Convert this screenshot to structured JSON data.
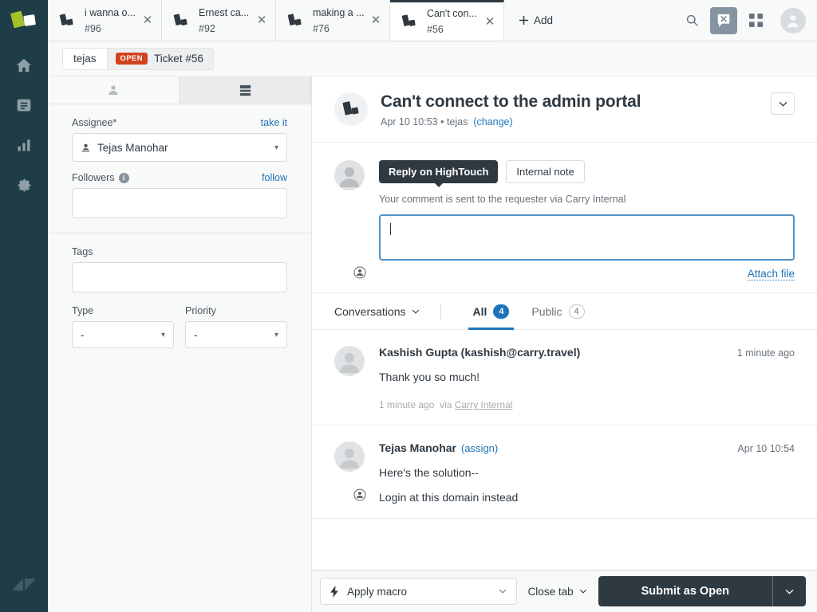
{
  "rail": {
    "logo_icon": "zendesk-cards-logo",
    "items": [
      {
        "icon": "home-icon",
        "name": "home"
      },
      {
        "icon": "views-list-icon",
        "name": "views"
      },
      {
        "icon": "reporting-bars-icon",
        "name": "reporting"
      },
      {
        "icon": "gear-icon",
        "name": "admin"
      }
    ],
    "footer_icon": "zendesk-logo"
  },
  "tabstrip": {
    "tabs": [
      {
        "title": "i wanna o...",
        "number": "#96",
        "active": false
      },
      {
        "title": "Ernest ca...",
        "number": "#92",
        "active": false
      },
      {
        "title": "making a ...",
        "number": "#76",
        "active": false
      },
      {
        "title": "Can't con...",
        "number": "#56",
        "active": true
      }
    ],
    "add_label": "Add",
    "close_glyph": "✕",
    "actions": [
      {
        "icon": "search-icon",
        "name": "search-button",
        "highlighted": false
      },
      {
        "icon": "chat-dismiss-icon",
        "name": "chat-status-button",
        "highlighted": true
      },
      {
        "icon": "apps-grid-icon",
        "name": "products-button",
        "highlighted": false
      }
    ],
    "avatar_icon": "user-avatar"
  },
  "breadcrumb": {
    "user": "tejas",
    "status": "OPEN",
    "ticket": "Ticket #56",
    "status_color": "#d2421c"
  },
  "properties": {
    "tabs": [
      {
        "icon": "user-icon",
        "name": "customer-context-tab",
        "active": true
      },
      {
        "icon": "apps-panel-icon",
        "name": "apps-tab",
        "active": false
      }
    ],
    "assignee": {
      "label": "Assignee*",
      "action": "take it",
      "value": "Tejas Manohar",
      "icon": "assignee-icon"
    },
    "followers": {
      "label": "Followers",
      "action": "follow",
      "value": "",
      "info_glyph": "i"
    },
    "tags": {
      "label": "Tags",
      "value": ""
    },
    "type": {
      "label": "Type",
      "value": "-"
    },
    "priority": {
      "label": "Priority",
      "value": "-"
    }
  },
  "ticket": {
    "icon": "ticket-cards-icon",
    "title": "Can't connect to the admin portal",
    "meta_date": "Apr 10 10:53",
    "meta_sep": "•",
    "meta_user": "tejas",
    "meta_change": "(change)",
    "options_caret": "⌄"
  },
  "composer": {
    "channel_active": "Reply on HighTouch",
    "channel_internal": "Internal note",
    "hint": "Your comment is sent to the requester via Carry Internal",
    "text": "",
    "attach_label": "Attach file",
    "avatar_icon": "agent-avatar"
  },
  "conversation": {
    "dropdown_label": "Conversations",
    "tabs": [
      {
        "label": "All",
        "count": "4",
        "active": true
      },
      {
        "label": "Public",
        "count": "4",
        "active": false
      }
    ],
    "accent_color": "#1f73b7"
  },
  "comments": [
    {
      "author": "Kashish Gupta (kashish@carry.travel)",
      "action": "",
      "time": "1 minute ago",
      "lines": [
        "Thank you so much!"
      ],
      "footer_time": "1 minute ago",
      "footer_via": "via",
      "footer_channel": "Carry Internal",
      "avatar_icon": "user-avatar",
      "has_agent_badge": false
    },
    {
      "author": "Tejas Manohar",
      "action": "(assign)",
      "time": "Apr 10 10:54",
      "lines": [
        "Here's the solution--",
        "Login at this domain instead"
      ],
      "footer_time": "",
      "footer_via": "",
      "footer_channel": "",
      "avatar_icon": "agent-avatar",
      "has_agent_badge": true
    }
  ],
  "footer": {
    "macro_label": "Apply macro",
    "macro_icon": "lightning-bolt-icon",
    "close_tab_label": "Close tab",
    "submit_label": "Submit as Open",
    "submit_color": "#2f3941"
  }
}
